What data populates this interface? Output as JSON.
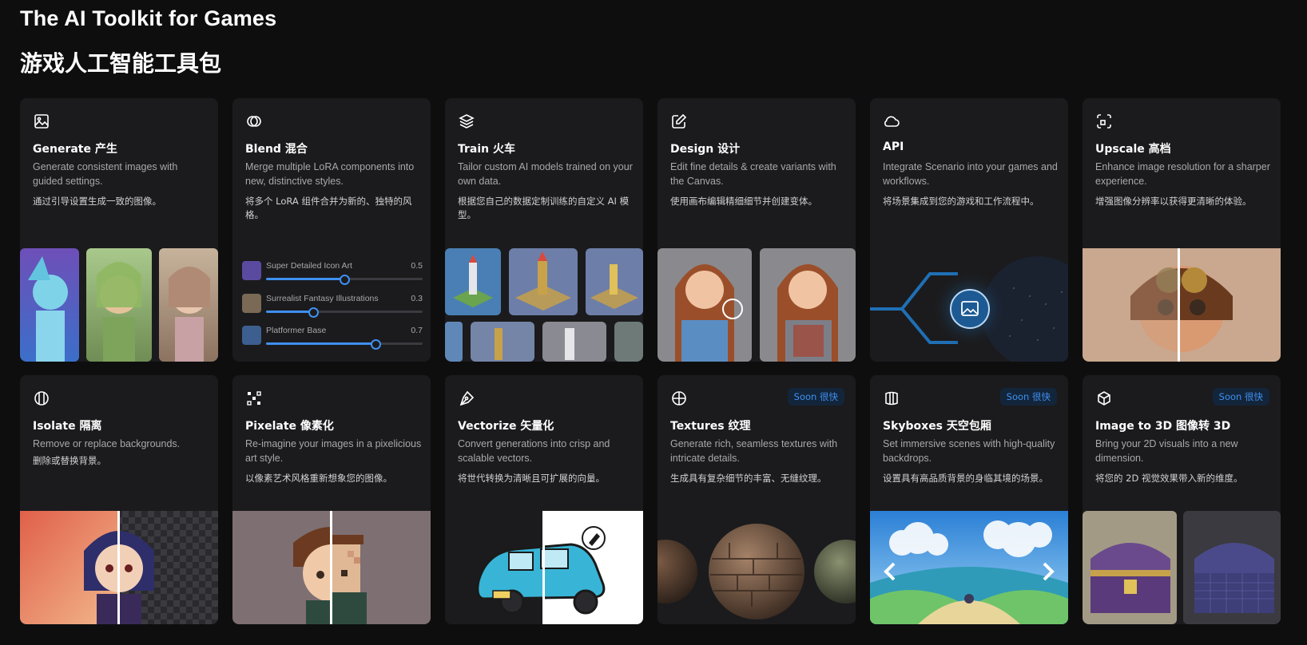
{
  "header": {
    "title_en": "The AI Toolkit for Games",
    "title_cn": "游戏人工智能工具包"
  },
  "colors": {
    "background": "#0e0e0f",
    "card": "#1b1b1d",
    "accent": "#3f8ff0",
    "badge_bg": "#13253a"
  },
  "cards": [
    {
      "icon": "image-icon",
      "title": "Generate 产生",
      "desc": "Generate consistent images with guided settings.",
      "cn": "通过引导设置生成一致的图像。"
    },
    {
      "icon": "blend-circles-icon",
      "title": "Blend 混合",
      "desc": "Merge multiple LoRA components into new, distinctive styles.",
      "cn": "将多个 LoRA 组件合并为新的、独特的风格。"
    },
    {
      "icon": "layers-icon",
      "title": "Train 火车",
      "desc": "Tailor custom AI models trained on your own data.",
      "cn": "根据您自己的数据定制训练的自定义 AI 模型。"
    },
    {
      "icon": "edit-icon",
      "title": "Design 设计",
      "desc": "Edit fine details & create variants with the Canvas.",
      "cn": "使用画布编辑精细细节并创建变体。"
    },
    {
      "icon": "cloud-icon",
      "title": "API",
      "desc": "Integrate Scenario into your games and workflows.",
      "cn": "将场景集成到您的游戏和工作流程中。"
    },
    {
      "icon": "upscale-icon",
      "title": "Upscale 高档",
      "desc": "Enhance image resolution for a sharper experience.",
      "cn": "增强图像分辨率以获得更清晰的体验。"
    },
    {
      "icon": "isolate-icon",
      "title": "Isolate 隔离",
      "desc": "Remove or replace backgrounds.",
      "cn": "删除或替换背景。"
    },
    {
      "icon": "pixelate-icon",
      "title": "Pixelate 像素化",
      "desc": "Re-imagine your images in a pixelicious art style.",
      "cn": "以像素艺术风格重新想象您的图像。"
    },
    {
      "icon": "pen-icon",
      "title": "Vectorize 矢量化",
      "desc": "Convert generations into crisp and scalable vectors.",
      "cn": "将世代转换为清晰且可扩展的向量。"
    },
    {
      "icon": "globe-icon",
      "title": "Textures 纹理",
      "desc": "Generate rich, seamless textures with intricate details.",
      "cn": "生成具有复杂细节的丰富、无缝纹理。",
      "badge": "Soon 很快"
    },
    {
      "icon": "cylinder-icon",
      "title": "Skyboxes 天空包厢",
      "desc": "Set immersive scenes with high-quality backdrops.",
      "cn": "设置具有高品质背景的身临其境的场景。",
      "badge": "Soon 很快"
    },
    {
      "icon": "cube-icon",
      "title": "Image to 3D 图像转 3D",
      "desc": "Bring your 2D visuals into a new dimension.",
      "cn": "将您的 2D 视觉效果带入新的维度。",
      "badge": "Soon 很快"
    }
  ],
  "blend_sliders": [
    {
      "label": "Super Detailed Icon Art",
      "value": "0.5",
      "level": 0.5
    },
    {
      "label": "Surrealist Fantasy Illustrations",
      "value": "0.3",
      "level": 0.3
    },
    {
      "label": "Platformer Base",
      "value": "0.7",
      "level": 0.7
    }
  ]
}
